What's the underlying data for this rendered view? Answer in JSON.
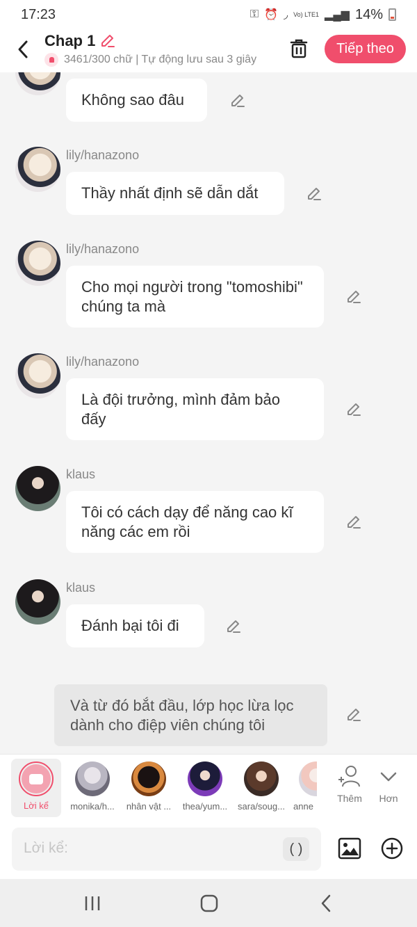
{
  "status_bar": {
    "time": "17:23",
    "battery": "14%",
    "network_label": "Vo) LTE1"
  },
  "header": {
    "title": "Chap 1",
    "subtitle": "3461/300 chữ | Tự động lưu sau 3 giây",
    "next_label": "Tiếp theo",
    "accent_color": "#f04e6c"
  },
  "messages": [
    {
      "name": "",
      "text": "Không sao đâu"
    },
    {
      "name": "lily/hanazono",
      "text": "Thầy nhất định sẽ dẫn dắt"
    },
    {
      "name": "lily/hanazono",
      "text": "Cho mọi người trong \"tomoshibi\" chúng ta mà"
    },
    {
      "name": "lily/hanazono",
      "text": "Là đội trưởng, mình đảm bảo đấy"
    },
    {
      "name": "klaus",
      "text": "Tôi có cách dạy để năng cao kĩ năng các em rồi"
    },
    {
      "name": "klaus",
      "text": "Đánh bại tôi đi"
    }
  ],
  "narration": {
    "text": "Và từ đó bắt đầu, lớp học lừa lọc dành cho điệp viên chúng tôi"
  },
  "characters": {
    "narrator": "Lời kể",
    "list": [
      "monika/h...",
      "nhân vật ...",
      "thea/yum...",
      "sara/soug...",
      "anne"
    ],
    "add_label": "Thêm",
    "more_label": "Hơn"
  },
  "input": {
    "placeholder": "Lời kể:",
    "paren_label": "( )"
  }
}
